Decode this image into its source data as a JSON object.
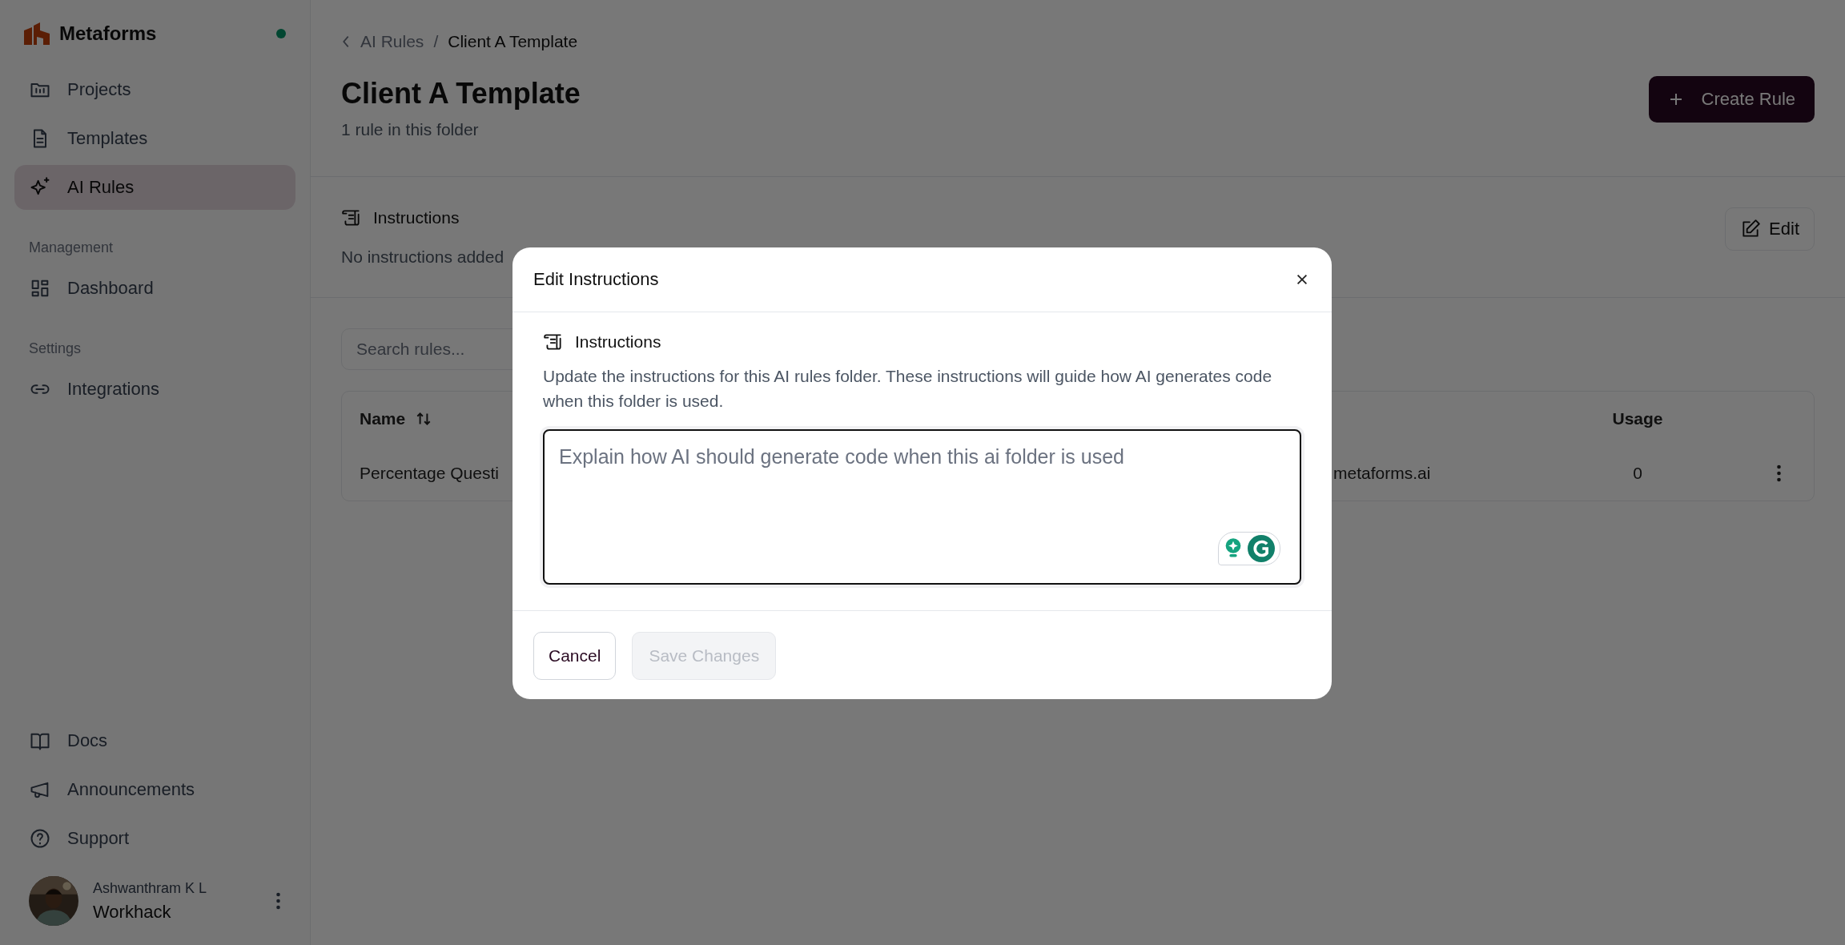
{
  "sidebar": {
    "brand": "Metaforms",
    "groups": [
      {
        "items": [
          {
            "label": "Projects",
            "selected": false
          },
          {
            "label": "Templates",
            "selected": false
          },
          {
            "label": "AI Rules",
            "selected": true
          }
        ]
      },
      {
        "heading": "Management",
        "items": [
          {
            "label": "Dashboard",
            "selected": false
          }
        ]
      },
      {
        "heading": "Settings",
        "items": [
          {
            "label": "Integrations",
            "selected": false
          }
        ]
      }
    ],
    "footer_items": [
      {
        "label": "Docs"
      },
      {
        "label": "Announcements"
      },
      {
        "label": "Support"
      }
    ],
    "user": {
      "name": "Ashwanthram K L",
      "org": "Workhack"
    }
  },
  "main": {
    "breadcrumb": {
      "parent": "AI Rules",
      "separator": "/",
      "current": "Client A Template"
    },
    "title": "Client A Template",
    "subtitle": "1 rule in this folder",
    "create_button": "Create Rule",
    "instructions": {
      "title": "Instructions",
      "text": "No instructions added",
      "edit_button": "Edit"
    },
    "search": {
      "placeholder": "Search rules..."
    },
    "table": {
      "columns": [
        "Name",
        "",
        "Usage"
      ],
      "rows": [
        {
          "cells": [
            "Percentage Questi",
            "metaforms.ai",
            "0"
          ]
        }
      ]
    }
  },
  "modal": {
    "title": "Edit Instructions",
    "section_title": "Instructions",
    "description": "Update the instructions for this AI rules folder. These instructions will guide how AI generates code when this folder is used.",
    "field": {
      "placeholder": "Explain how AI should generate code when this ai folder is used"
    },
    "cancel_button": "Cancel",
    "save_button": {
      "label": "Save Changes",
      "disabled": true
    }
  }
}
